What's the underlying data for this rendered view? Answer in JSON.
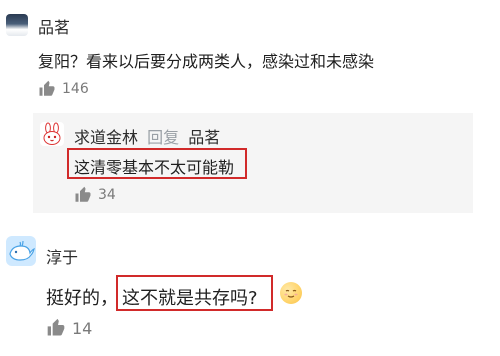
{
  "comments": [
    {
      "username": "品茗",
      "text": "复阳？看来以后要分成两类人，感染过和未感染",
      "likes": "146",
      "avatar": "night-sky-avatar",
      "reply": {
        "username": "求道金林",
        "reply_label": "回复",
        "reply_to": "品茗",
        "text": "这清零基本不太可能勒",
        "likes": "34",
        "avatar": "rabbit-avatar"
      }
    },
    {
      "username": "淳于",
      "text_before": "挺好的，",
      "text_highlight": "这不就是共存吗?",
      "emoji": "smiling-face-emoji",
      "likes": "14",
      "avatar": "whale-avatar"
    }
  ],
  "colors": {
    "highlight_border": "#d12a2a",
    "reply_bg": "#f5f5f5",
    "muted": "#7a7a7a"
  }
}
